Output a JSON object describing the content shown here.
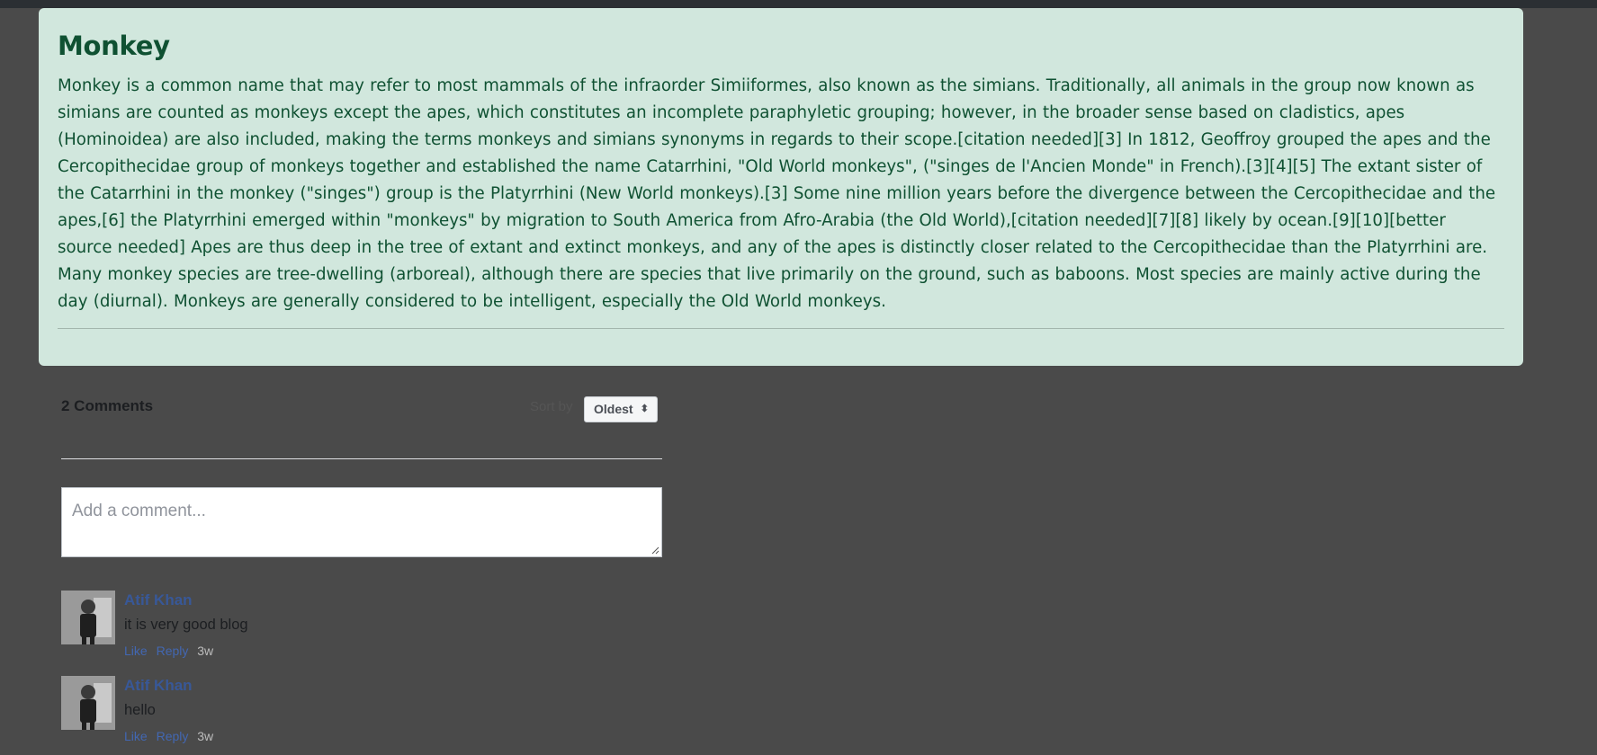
{
  "article": {
    "title": "Monkey",
    "body": "Monkey is a common name that may refer to most mammals of the infraorder Simiiformes, also known as the simians. Traditionally, all animals in the group now known as simians are counted as monkeys except the apes, which constitutes an incomplete paraphyletic grouping; however, in the broader sense based on cladistics, apes (Hominoidea) are also included, making the terms monkeys and simians synonyms in regards to their scope.[citation needed][3] In 1812, Geoffroy grouped the apes and the Cercopithecidae group of monkeys together and established the name Catarrhini, \"Old World monkeys\", (\"singes de l'Ancien Monde\" in French).[3][4][5] The extant sister of the Catarrhini in the monkey (\"singes\") group is the Platyrrhini (New World monkeys).[3] Some nine million years before the divergence between the Cercopithecidae and the apes,[6] the Platyrrhini emerged within \"monkeys\" by migration to South America from Afro-Arabia (the Old World),[citation needed][7][8] likely by ocean.[9][10][better source needed] Apes are thus deep in the tree of extant and extinct monkeys, and any of the apes is distinctly closer related to the Cercopithecidae than the Platyrrhini are. Many monkey species are tree-dwelling (arboreal), although there are species that live primarily on the ground, such as baboons. Most species are mainly active during the day (diurnal). Monkeys are generally considered to be intelligent, especially the Old World monkeys."
  },
  "comments_section": {
    "count_label": "2 Comments",
    "sort_label": "Sort by",
    "sort_value": "Oldest",
    "input_placeholder": "Add a comment...",
    "comments": [
      {
        "author": "Atif Khan",
        "text": "it is very good blog",
        "like": "Like",
        "reply": "Reply",
        "time": "3w"
      },
      {
        "author": "Atif Khan",
        "text": "hello",
        "like": "Like",
        "reply": "Reply",
        "time": "3w"
      }
    ]
  },
  "colors": {
    "page_bg": "#4a4a4a",
    "article_bg": "#d1e7dd",
    "article_text": "#0f5132",
    "link": "#4267b2"
  }
}
